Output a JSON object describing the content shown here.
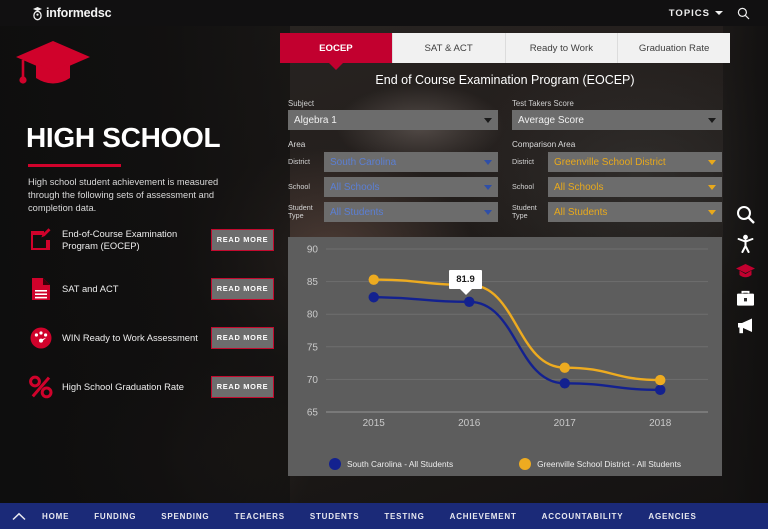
{
  "header": {
    "logo_text": "informedsc",
    "logo_icon": "torch-grad-icon",
    "topics_label": "TOPICS",
    "search_icon": "search-icon",
    "chevron_icon": "chevron-down-icon"
  },
  "sidebar": {
    "cap_icon": "graduation-cap-icon",
    "title": "HIGH SCHOOL",
    "description": "High school student achievement is measured through the following sets of assessment and completion data.",
    "items": [
      {
        "label": "End-of-Course Examination Program (EOCEP)",
        "icon": "pencil-square-icon",
        "button": "READ MORE"
      },
      {
        "label": "SAT and ACT",
        "icon": "document-icon",
        "button": "READ MORE"
      },
      {
        "label": "WIN Ready to Work Assessment",
        "icon": "gauge-icon",
        "button": "READ MORE"
      },
      {
        "label": "High School Graduation Rate",
        "icon": "percent-icon",
        "button": "READ MORE"
      }
    ]
  },
  "tabs": [
    {
      "label": "EOCEP",
      "active": true
    },
    {
      "label": "SAT & ACT",
      "active": false
    },
    {
      "label": "Ready to Work",
      "active": false
    },
    {
      "label": "Graduation Rate",
      "active": false
    }
  ],
  "main": {
    "title": "End of Course Examination Program (EOCEP)",
    "subject": {
      "label": "Subject",
      "value": "Algebra 1"
    },
    "test_takers": {
      "label": "Test Takers Score",
      "value": "Average Score"
    },
    "area": {
      "heading": "Area",
      "district": {
        "label": "District",
        "value": "South Carolina"
      },
      "school": {
        "label": "School",
        "value": "All Schools"
      },
      "student_type": {
        "label": "Student Type",
        "value": "All Students"
      }
    },
    "comparison_area": {
      "heading": "Comparison Area",
      "district": {
        "label": "District",
        "value": "Greenville School District"
      },
      "school": {
        "label": "School",
        "value": "All Schools"
      },
      "student_type": {
        "label": "Student Type",
        "value": "All Students"
      }
    }
  },
  "chart_data": {
    "type": "line",
    "title": "",
    "xlabel": "",
    "ylabel": "",
    "x": [
      "2015",
      "2016",
      "2017",
      "2018"
    ],
    "categories": [
      "2015",
      "2016",
      "2017",
      "2018"
    ],
    "ylim": [
      65,
      90
    ],
    "yticks": [
      65,
      70,
      75,
      80,
      85,
      90
    ],
    "grid": true,
    "legend_position": "bottom",
    "tooltip": {
      "value": "81.9",
      "series": "South Carolina - All Students",
      "x": "2016"
    },
    "series": [
      {
        "name": "South Carolina - All Students",
        "color": "#13218f",
        "values": [
          82.6,
          81.9,
          69.4,
          68.4
        ]
      },
      {
        "name": "Greenville School District - All Students",
        "color": "#edab20",
        "values": [
          85.3,
          84.5,
          71.8,
          69.9
        ]
      }
    ]
  },
  "rail": [
    {
      "icon": "search-icon",
      "name": "search"
    },
    {
      "icon": "person-icon",
      "name": "student"
    },
    {
      "icon": "graduation-cap-icon",
      "name": "education",
      "active": true
    },
    {
      "icon": "briefcase-icon",
      "name": "workforce"
    },
    {
      "icon": "megaphone-icon",
      "name": "announcements"
    }
  ],
  "bottom_nav": {
    "collapse_icon": "chevron-up-icon",
    "items": [
      "HOME",
      "FUNDING",
      "SPENDING",
      "TEACHERS",
      "STUDENTS",
      "TESTING",
      "ACHIEVEMENT",
      "ACCOUNTABILITY",
      "AGENCIES"
    ]
  },
  "colors": {
    "brand_red": "#c2002f",
    "series_blue": "#13218f",
    "series_gold": "#edab20",
    "nav_blue": "#1b2a78",
    "panel_gray": "#5d5d5d"
  }
}
